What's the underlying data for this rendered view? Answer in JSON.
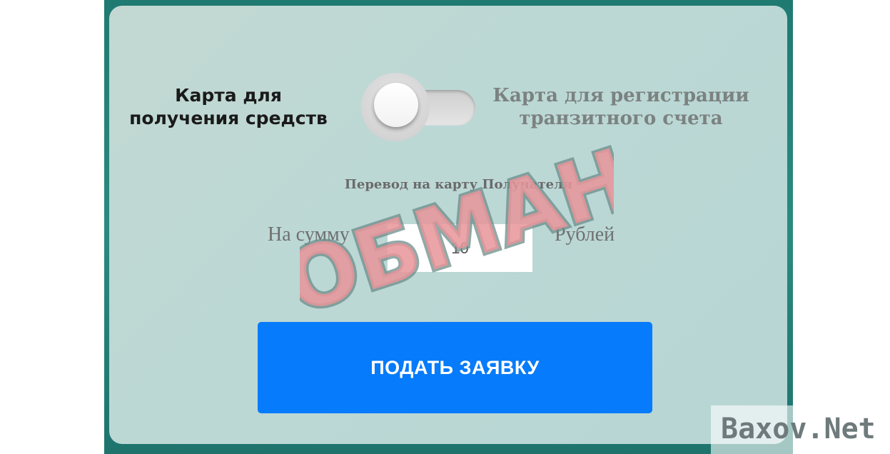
{
  "card_selector": {
    "left_label": "Карта для\nполучения средств",
    "right_label": "Карта для регистрации\nтранзитного счета",
    "toggle_state": "left"
  },
  "transfer": {
    "title": "Перевод на карту Получателя",
    "amount_label": "На сумму",
    "amount_value": "10",
    "currency_label": "Рублей"
  },
  "submit": {
    "label": "ПОДАТЬ ЗАЯВКУ"
  },
  "overlay": {
    "stamp_text": "ОБМАН",
    "watermark_text": "Baxov.Net"
  },
  "colors": {
    "frame": "#1f7a72",
    "card": "#bcd8d5",
    "button": "#067bfb",
    "stamp_fill": "#e8959a",
    "stamp_outline": "#6b8c8a"
  }
}
